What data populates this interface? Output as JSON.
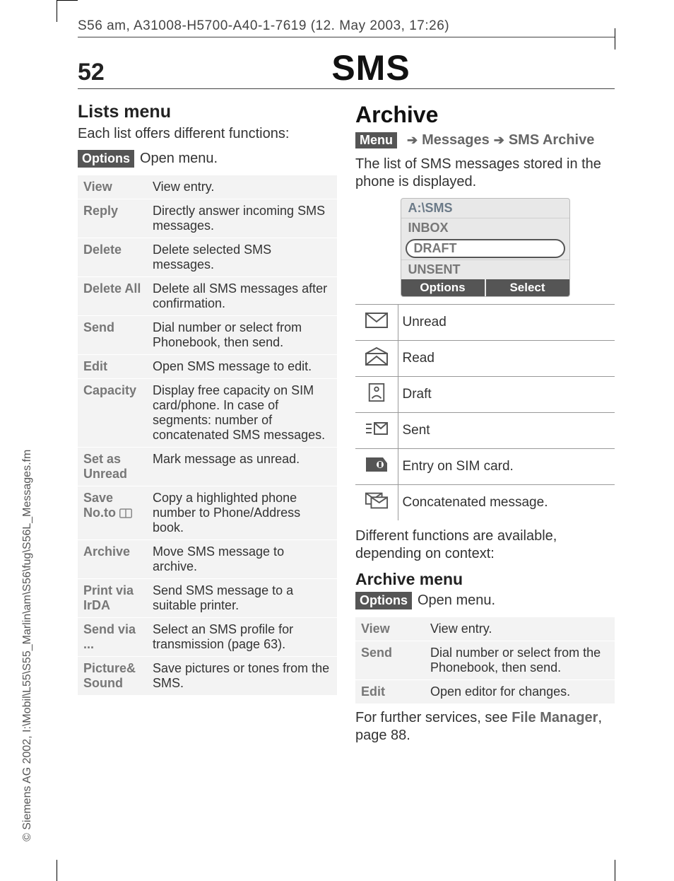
{
  "header": "S56 am, A31008-H5700-A40-1-7619 (12. May 2003, 17:26)",
  "page_number": "52",
  "page_title": "SMS",
  "side_text": "© Siemens AG 2002, I:\\Mobil\\L55\\S55_Marlin\\am\\S56\\fug\\S56L_Messages.fm",
  "left": {
    "heading": "Lists menu",
    "intro": "Each list offers different functions:",
    "options_label": "Options",
    "options_desc": "Open menu.",
    "rows": [
      {
        "k": "View",
        "v": "View entry."
      },
      {
        "k": "Reply",
        "v": "Directly answer incoming SMS messages."
      },
      {
        "k": "Delete",
        "v": "Delete selected SMS messages."
      },
      {
        "k": "Delete All",
        "v": "Delete all SMS messages after confirmation."
      },
      {
        "k": "Send",
        "v": "Dial number or select from Phonebook, then send."
      },
      {
        "k": "Edit",
        "v": "Open SMS message to edit."
      },
      {
        "k": "Capacity",
        "v": "Display free capacity on SIM card/phone. In case of segments: number of concatenated SMS messages."
      },
      {
        "k": "Set as Unread",
        "v": "Mark message as unread."
      },
      {
        "k": "Save No.to ",
        "v": "Copy a highlighted phone number to Phone/Address book."
      },
      {
        "k": "Archive",
        "v": "Move SMS message to archive."
      },
      {
        "k": "Print via IrDA",
        "v": "Send SMS message to a suitable printer."
      },
      {
        "k": "Send via ...",
        "v": "Select an SMS profile for transmission (page 63)."
      },
      {
        "k": "Picture& Sound",
        "v": "Save pictures or tones from the SMS."
      }
    ]
  },
  "right": {
    "heading": "Archive",
    "nav": {
      "menu": "Menu",
      "a": "Messages",
      "b": "SMS Archive"
    },
    "intro": "The list of SMS messages stored in the phone is displayed.",
    "phone": {
      "path": "A:\\SMS",
      "items": [
        "INBOX",
        "DRAFT",
        "UNSENT"
      ],
      "selected": "DRAFT",
      "soft_left": "Options",
      "soft_right": "Select"
    },
    "legend": [
      {
        "icon": "unread",
        "label": "Unread"
      },
      {
        "icon": "read",
        "label": "Read"
      },
      {
        "icon": "draft",
        "label": "Draft"
      },
      {
        "icon": "sent",
        "label": "Sent"
      },
      {
        "icon": "sim",
        "label": "Entry on SIM card."
      },
      {
        "icon": "concat",
        "label": "Concatenated message."
      }
    ],
    "context": "Different functions are available, depending on context:",
    "archive_menu_heading": "Archive menu",
    "options_label": "Options",
    "options_desc": "Open menu.",
    "rows": [
      {
        "k": "View",
        "v": "View entry."
      },
      {
        "k": "Send",
        "v": "Dial number or select from the Phonebook, then send."
      },
      {
        "k": "Edit",
        "v": "Open editor for changes."
      }
    ],
    "further_a": "For further services, see ",
    "further_b": "File Manager",
    "further_c": ", page 88."
  }
}
